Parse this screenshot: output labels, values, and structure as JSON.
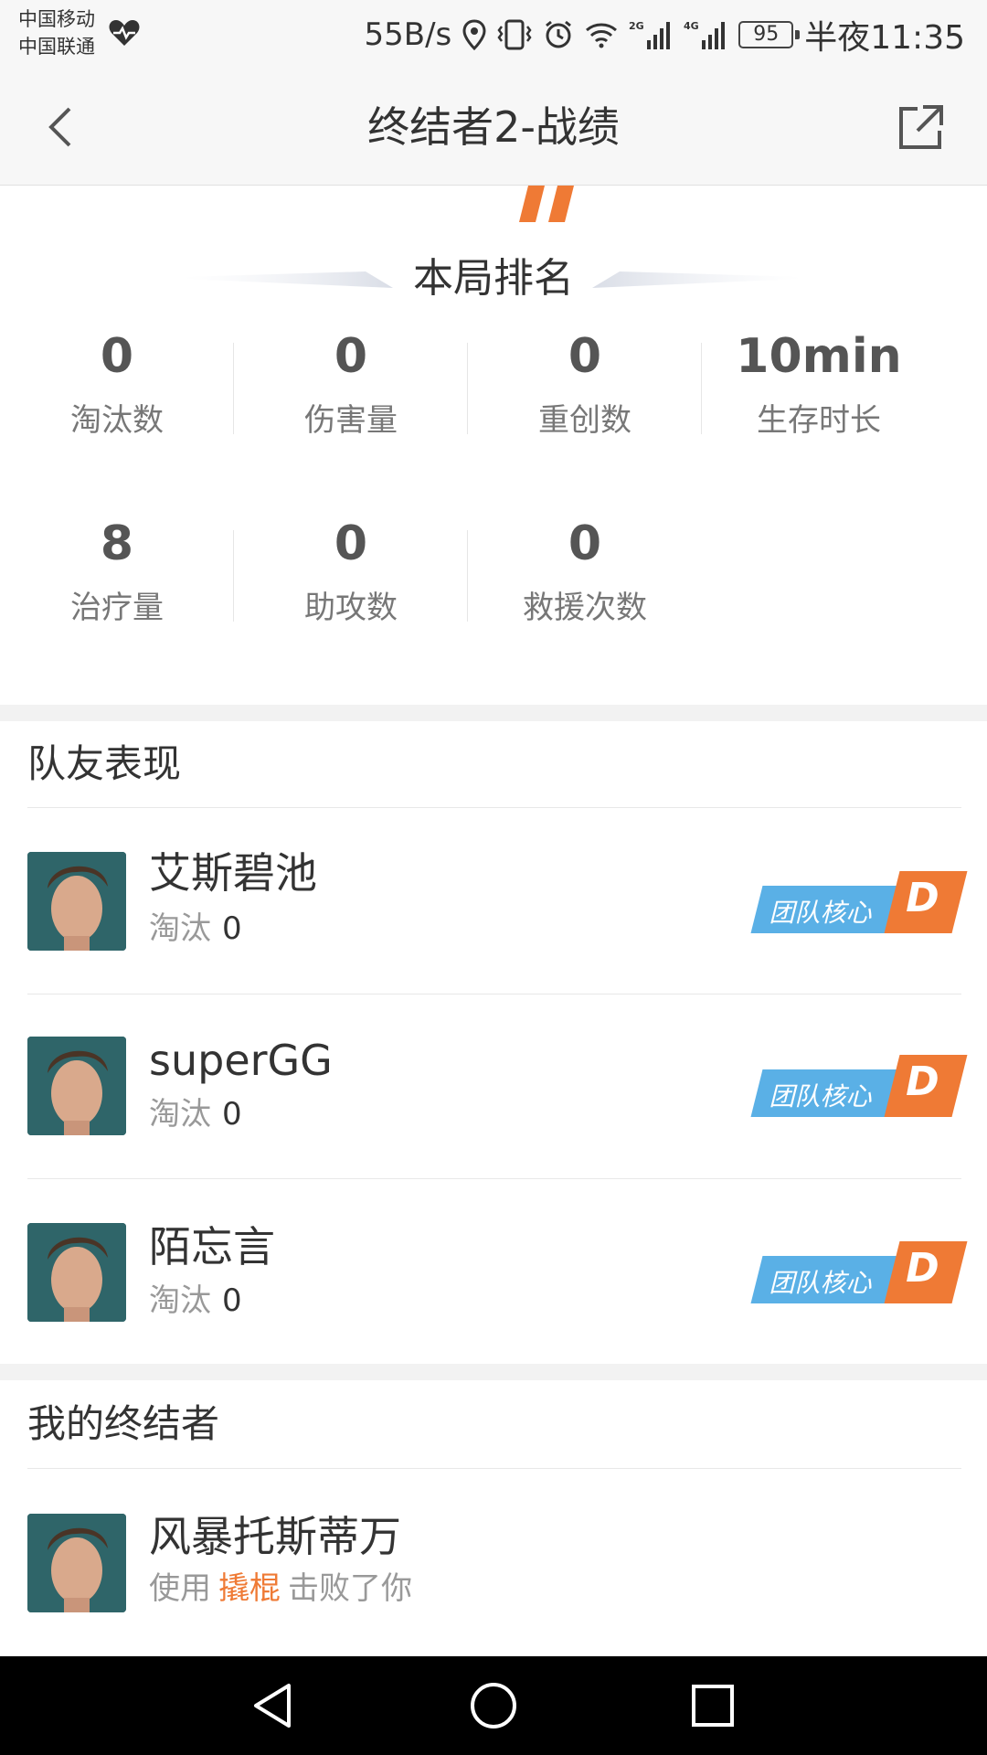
{
  "status_bar": {
    "carrier_1": "中国移动",
    "carrier_2": "中国联通",
    "net_speed": "55B/s",
    "net_2g": "2G",
    "net_4g": "4G",
    "battery": "95",
    "time": "半夜11:35"
  },
  "nav": {
    "title": "终结者2-战绩"
  },
  "ranking": {
    "title": "本局排名"
  },
  "stats": [
    {
      "value": "0",
      "label": "淘汰数"
    },
    {
      "value": "0",
      "label": "伤害量"
    },
    {
      "value": "0",
      "label": "重创数"
    },
    {
      "value": "10min",
      "label": "生存时长"
    },
    {
      "value": "8",
      "label": "治疗量"
    },
    {
      "value": "0",
      "label": "助攻数"
    },
    {
      "value": "0",
      "label": "救援次数"
    }
  ],
  "teammates": {
    "title": "队友表现",
    "players": [
      {
        "name": "艾斯碧池",
        "kills_label": "淘汰",
        "kills": "0",
        "badge": "团队核心",
        "grade": "D"
      },
      {
        "name": "superGG",
        "kills_label": "淘汰",
        "kills": "0",
        "badge": "团队核心",
        "grade": "D"
      },
      {
        "name": "陌忘言",
        "kills_label": "淘汰",
        "kills": "0",
        "badge": "团队核心",
        "grade": "D"
      }
    ]
  },
  "killer": {
    "title": "我的终结者",
    "name": "风暴托斯蒂万",
    "prefix": "使用",
    "weapon": "撬棍",
    "suffix": "击败了你"
  },
  "colors": {
    "accent_orange": "#ef7a35",
    "badge_blue": "#5ab0e6"
  }
}
